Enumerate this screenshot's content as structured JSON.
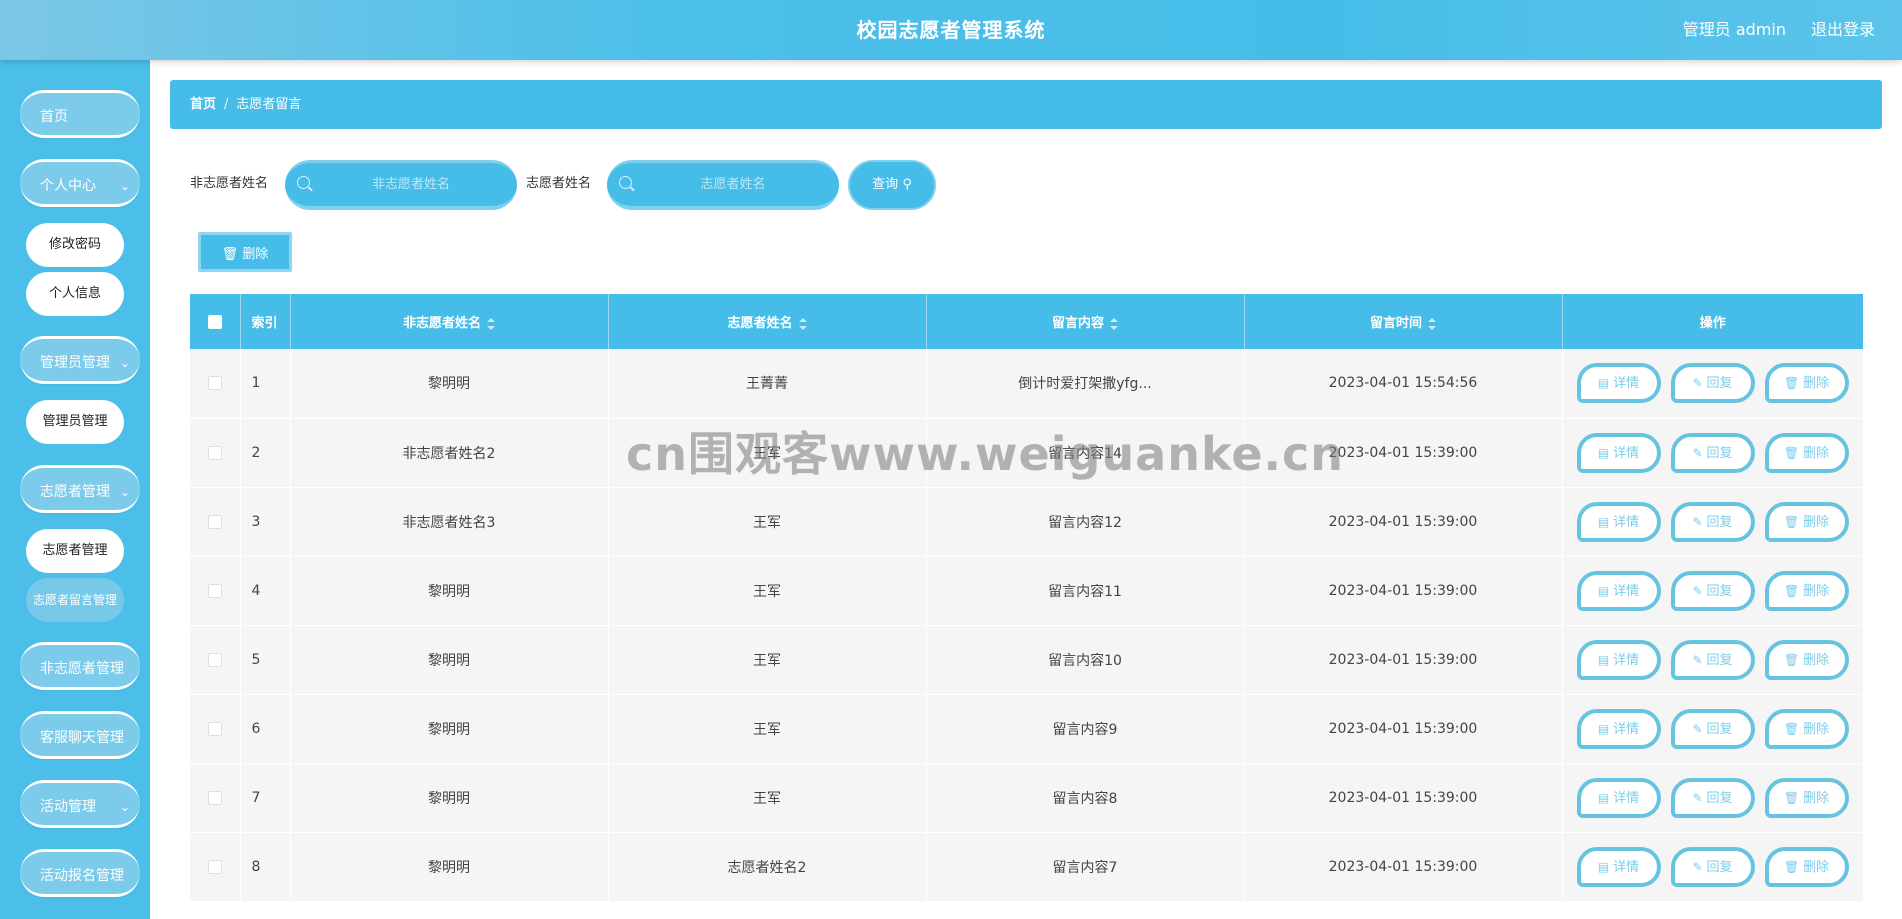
{
  "header": {
    "title": "校园志愿者管理系统",
    "user": "管理员 admin",
    "logout": "退出登录"
  },
  "sidebar": {
    "home": "首页",
    "personal_center": "个人中心",
    "change_password": "修改密码",
    "personal_info": "个人信息",
    "admin_manage": "管理员管理",
    "admin_manage_sub": "管理员管理",
    "volunteer_manage": "志愿者管理",
    "volunteer_manage_sub": "志愿者管理",
    "volunteer_msg_manage": "志愿者留言管理",
    "non_volunteer_manage": "非志愿者管理",
    "support_chat_manage": "客服聊天管理",
    "activity_manage": "活动管理",
    "activity_signup_manage": "活动报名管理"
  },
  "breadcrumb": {
    "home": "首页",
    "sep": "/",
    "current": "志愿者留言"
  },
  "search": {
    "non_volunteer_label": "非志愿者姓名",
    "non_volunteer_placeholder": "非志愿者姓名",
    "volunteer_label": "志愿者姓名",
    "volunteer_placeholder": "志愿者姓名",
    "query_label": "查询",
    "delete_label": "删除"
  },
  "table": {
    "columns": [
      "索引",
      "非志愿者姓名",
      "志愿者姓名",
      "留言内容",
      "留言时间",
      "操作"
    ],
    "actions": {
      "detail": "详情",
      "reply": "回复",
      "delete": "删除"
    },
    "rows": [
      {
        "index": "1",
        "non_volunteer": "黎明明",
        "volunteer": "王菁菁",
        "content": "倒计时爱打架撒yfg...",
        "time": "2023-04-01 15:54:56"
      },
      {
        "index": "2",
        "non_volunteer": "非志愿者姓名2",
        "volunteer": "王军",
        "content": "留言内容14",
        "time": "2023-04-01 15:39:00"
      },
      {
        "index": "3",
        "non_volunteer": "非志愿者姓名3",
        "volunteer": "王军",
        "content": "留言内容12",
        "time": "2023-04-01 15:39:00"
      },
      {
        "index": "4",
        "non_volunteer": "黎明明",
        "volunteer": "王军",
        "content": "留言内容11",
        "time": "2023-04-01 15:39:00"
      },
      {
        "index": "5",
        "non_volunteer": "黎明明",
        "volunteer": "王军",
        "content": "留言内容10",
        "time": "2023-04-01 15:39:00"
      },
      {
        "index": "6",
        "non_volunteer": "黎明明",
        "volunteer": "王军",
        "content": "留言内容9",
        "time": "2023-04-01 15:39:00"
      },
      {
        "index": "7",
        "non_volunteer": "黎明明",
        "volunteer": "王军",
        "content": "留言内容8",
        "time": "2023-04-01 15:39:00"
      },
      {
        "index": "8",
        "non_volunteer": "黎明明",
        "volunteer": "志愿者姓名2",
        "content": "留言内容7",
        "time": "2023-04-01 15:39:00"
      }
    ]
  },
  "watermark": "cn围观客www.weiguanke.cn",
  "colors": {
    "primary": "#46bde9",
    "button_border": "#67c4e1",
    "row_bg": "#f5f5f5"
  }
}
